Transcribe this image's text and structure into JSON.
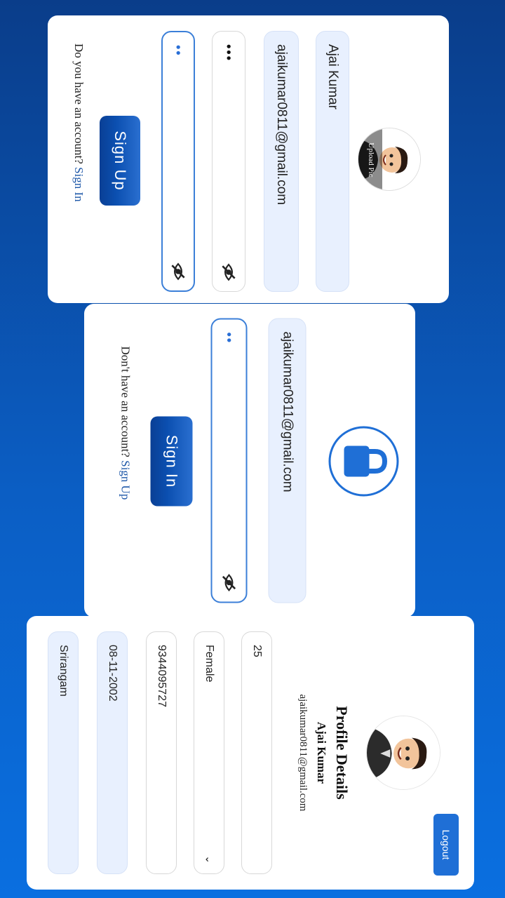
{
  "signup": {
    "avatar_caption": "Upload Pic",
    "name_value": "Ajai Kumar",
    "email_value": "ajaikumar0811@gmail.com",
    "password_dots": "•••",
    "confirm_dots": "••",
    "button_label": "Sign Up",
    "footer_text": "Do you have an account?",
    "footer_link": "Sign In"
  },
  "signin": {
    "email_value": "ajaikumar0811@gmail.com",
    "password_dots": "••",
    "button_label": "Sign In",
    "footer_text": "Don't have an account?",
    "footer_link": "Sign Up"
  },
  "profile": {
    "logout_label": "Logout",
    "title": "Profile Details",
    "name": "Ajai Kumar",
    "email": "ajaikumar0811@gmail.com",
    "age": "25",
    "gender": "Female",
    "phone": "9344095727",
    "dob": "08-11-2002",
    "location": "Srirangam"
  },
  "colors": {
    "background_top": "#0a3d8a",
    "background_bottom": "#0a6fe0",
    "accent": "#1f6fd6",
    "field_fill": "#e8f0fe"
  }
}
